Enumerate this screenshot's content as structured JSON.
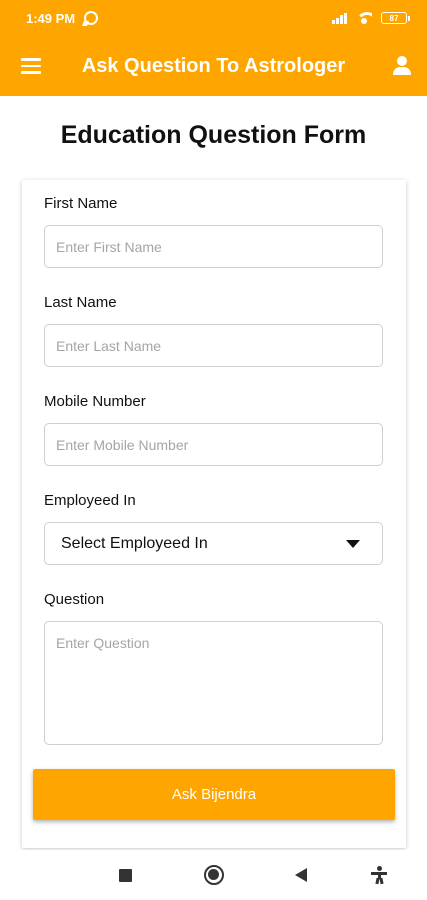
{
  "status_bar": {
    "time": "1:49 PM",
    "battery": "87",
    "icons": [
      "whatsapp-icon",
      "signal-icon",
      "wifi-icon",
      "battery-icon"
    ]
  },
  "app_bar": {
    "title": "Ask Question To Astrologer",
    "left_icon": "menu-icon",
    "right_icon": "account-icon"
  },
  "colors": {
    "primary": "#FFA500",
    "background": "#FFFFFF",
    "placeholder": "#A5A5A5",
    "border": "#CFCFCF"
  },
  "form": {
    "title": "Education Question Form",
    "fields": {
      "first_name": {
        "label": "First Name",
        "placeholder": "Enter First Name",
        "value": ""
      },
      "last_name": {
        "label": "Last Name",
        "placeholder": "Enter Last Name",
        "value": ""
      },
      "mobile": {
        "label": "Mobile Number",
        "placeholder": "Enter Mobile Number",
        "value": ""
      },
      "employed": {
        "label": "Employeed In",
        "selected": "Select Employeed In"
      },
      "question": {
        "label": "Question",
        "placeholder": "Enter Question",
        "value": ""
      }
    },
    "submit_label": "Ask Bijendra"
  },
  "nav_bar": {
    "icons": [
      "recents-icon",
      "home-icon",
      "back-icon",
      "accessibility-icon"
    ]
  }
}
